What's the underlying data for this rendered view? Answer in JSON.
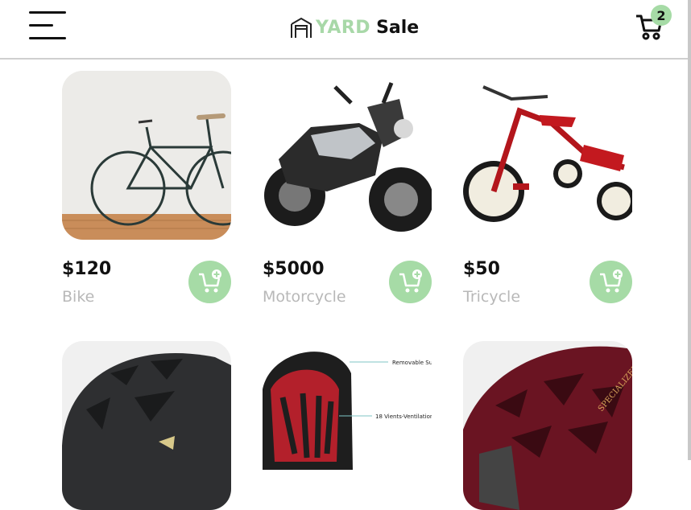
{
  "header": {
    "brand_yard": "YARD",
    "brand_sale": "Sale",
    "cart_count": "2",
    "icons": [
      "hamburger-menu-icon",
      "garage-logo-icon",
      "cart-icon"
    ]
  },
  "colors": {
    "accent": "#a6dba6",
    "brand_yard": "#a8d8a8",
    "name_gray": "#b8b8b8"
  },
  "products": [
    {
      "price": "$120",
      "name": "Bike",
      "image": "bicycle"
    },
    {
      "price": "$5000",
      "name": "Motorcycle",
      "image": "motorcycle"
    },
    {
      "price": "$50",
      "name": "Tricycle",
      "image": "tricycle"
    },
    {
      "image": "black-helmet"
    },
    {
      "image": "helmet-diagram",
      "callouts": [
        "Removable Sun",
        "18 Vients-Ventilation s"
      ]
    },
    {
      "image": "red-helmet",
      "helmet_text": "SPECIALIZED"
    }
  ]
}
